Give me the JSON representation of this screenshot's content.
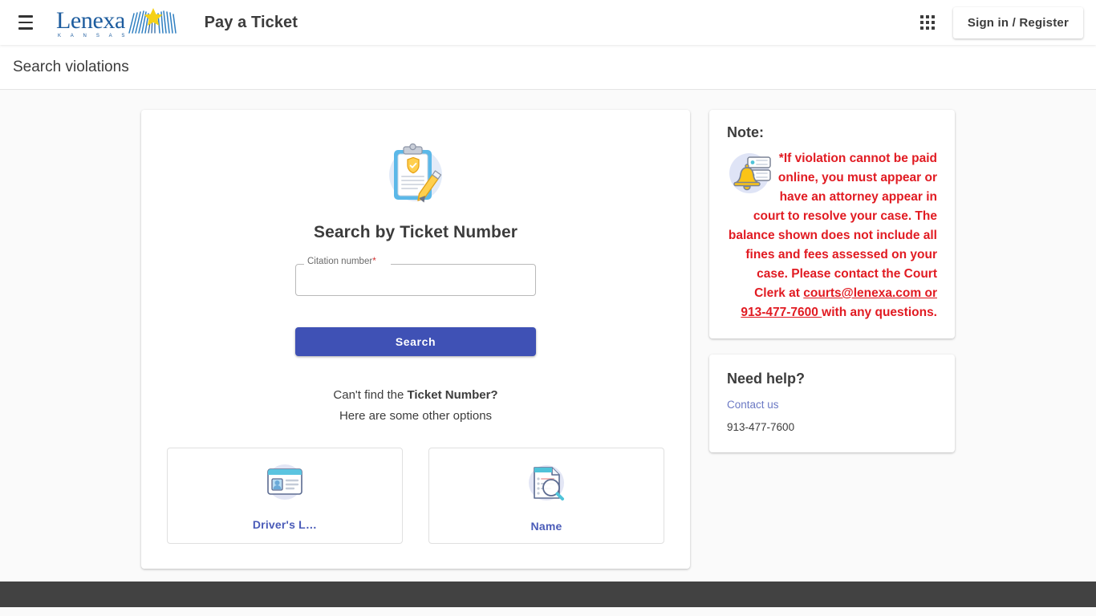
{
  "header": {
    "menu_icon": "hamburger-menu-icon",
    "logo": {
      "word": "Lenexa",
      "state": "K A N S A S",
      "burst_icon": "sunburst-logo-icon"
    },
    "app_title": "Pay a Ticket",
    "apps_icon": "apps-grid-icon",
    "signin_label": "Sign in / Register"
  },
  "subheader": {
    "title": "Search violations"
  },
  "search_card": {
    "icon": "clipboard-shield-icon",
    "heading": "Search by Ticket Number",
    "field": {
      "label": "Citation number",
      "required_mark": "*",
      "value": "",
      "placeholder": ""
    },
    "search_button": "Search",
    "hint_line1_prefix": "Can't find the ",
    "hint_line1_strong": "Ticket Number?",
    "hint_line2": "Here are some other options",
    "options": [
      {
        "label": "Driver's L…",
        "icon": "id-card-icon"
      },
      {
        "label": "Name",
        "icon": "document-search-icon"
      }
    ]
  },
  "note_panel": {
    "title": "Note:",
    "icon": "notification-bell-icon",
    "text_before": "*If violation cannot be paid online, you must appear or have an attorney appear in court to resolve your case.  The balance shown does not include all fines and fees assessed on your case.  Please contact the Court Clerk at ",
    "link_text": "courts@lenexa.com or 913-477-7600 ",
    "text_after": "with any questions."
  },
  "help_panel": {
    "title": "Need help?",
    "contact_link": "Contact us",
    "phone": "913-477-7600"
  },
  "colors": {
    "accent_indigo": "#3f51b5",
    "note_red": "#e11b22",
    "logo_blue": "#1d5c9e",
    "footer_gray": "#424242"
  }
}
